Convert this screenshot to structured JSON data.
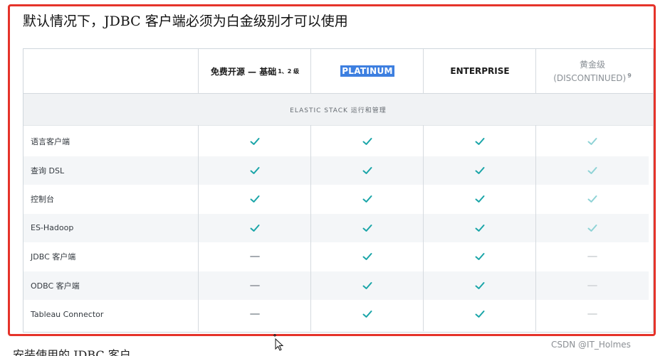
{
  "title": "默认情况下，JDBC 客户端必须为白金级别才可以使用",
  "table": {
    "columns": [
      {
        "label": "免费开源 — 基础",
        "sup": "1、2 级"
      },
      {
        "label": "PLATINUM",
        "sup": ""
      },
      {
        "label": "ENTERPRISE",
        "sup": ""
      },
      {
        "label": "黄金级",
        "sublabel": "(DISCONTINUED)",
        "sup": "9"
      }
    ],
    "section_label": "ELASTIC STACK 运行和管理",
    "rows": [
      {
        "feature": "语言客户端",
        "values": [
          "check",
          "check",
          "check",
          "check-light"
        ]
      },
      {
        "feature": "查询 DSL",
        "values": [
          "check",
          "check",
          "check",
          "check-light"
        ]
      },
      {
        "feature": "控制台",
        "values": [
          "check",
          "check",
          "check",
          "check-light"
        ]
      },
      {
        "feature": "ES-Hadoop",
        "values": [
          "check",
          "check",
          "check",
          "check-light"
        ]
      },
      {
        "feature": "JDBC 客户端",
        "values": [
          "dash",
          "check",
          "check",
          "dash-light"
        ]
      },
      {
        "feature": "ODBC 客户端",
        "values": [
          "dash",
          "check",
          "check",
          "dash-light"
        ]
      },
      {
        "feature": "Tableau Connector",
        "values": [
          "dash",
          "check",
          "check",
          "dash-light"
        ]
      }
    ]
  },
  "bottom_text": "安装使用的 JDBC 客户",
  "watermark": "CSDN @IT_Holmes",
  "colors": {
    "highlight_border": "#e5332a",
    "check": "#1aa5a8",
    "check_light": "#8fd3d6",
    "dash": "#9aa0a6",
    "dash_light": "#d4d7da",
    "platinum_highlight": "#3d7fe0"
  }
}
